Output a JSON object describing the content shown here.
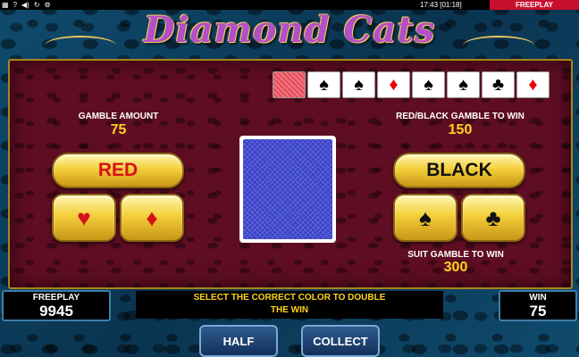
{
  "topbar": {
    "icons": [
      "flag-icon",
      "help-icon",
      "sound-icon",
      "reload-icon",
      "settings-icon"
    ],
    "clock": "17:43 [01:18]",
    "mode": "FREEPLAY"
  },
  "title": "Diamond Cats",
  "history": [
    {
      "type": "back",
      "suit": ""
    },
    {
      "type": "black",
      "suit": "♠"
    },
    {
      "type": "black",
      "suit": "♠"
    },
    {
      "type": "red",
      "suit": "♦"
    },
    {
      "type": "black",
      "suit": "♠"
    },
    {
      "type": "black",
      "suit": "♠"
    },
    {
      "type": "black",
      "suit": "♣"
    },
    {
      "type": "red",
      "suit": "♦"
    }
  ],
  "gamble": {
    "label": "GAMBLE AMOUNT",
    "value": "75"
  },
  "redblack": {
    "label": "RED/BLACK GAMBLE TO WIN",
    "value": "150"
  },
  "suit": {
    "label": "SUIT GAMBLE TO WIN",
    "value": "300"
  },
  "buttons": {
    "red": "RED",
    "black": "BLACK",
    "hearts": "♥",
    "diamonds": "♦",
    "spades": "♠",
    "clubs": "♣",
    "half": "HALF",
    "collect": "COLLECT"
  },
  "freeplay": {
    "label": "FREEPLAY",
    "value": "9945"
  },
  "win": {
    "label": "WIN",
    "value": "75"
  },
  "message": [
    "SELECT THE CORRECT COLOR TO DOUBLE",
    "THE WIN"
  ]
}
